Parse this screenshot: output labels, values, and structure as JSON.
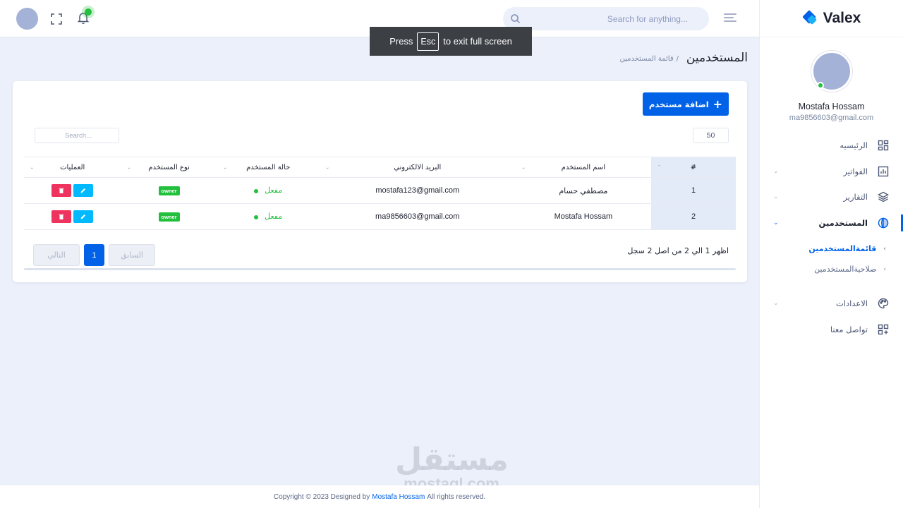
{
  "brand": {
    "name": "Valex"
  },
  "user": {
    "name": "Mostafa Hossam",
    "email": "ma9856603@gmail.com"
  },
  "sidebar": {
    "items": [
      {
        "label": "الرئيسيه",
        "icon": "dashboard-icon"
      },
      {
        "label": "الفواتير",
        "icon": "invoices-chart-icon"
      },
      {
        "label": "التقارير",
        "icon": "layers-icon"
      },
      {
        "label": "المستخدمين",
        "icon": "globe-icon"
      },
      {
        "label": "الاعدادات",
        "icon": "palette-icon"
      },
      {
        "label": "تواصل معنا",
        "icon": "grid-icon"
      }
    ],
    "sub_items": [
      {
        "label": "قائمةالمستخدمين"
      },
      {
        "label": "صلاحيةالمستخدمين"
      }
    ]
  },
  "header": {
    "search_placeholder": "Search for anything..."
  },
  "toast": {
    "press": "Press",
    "key": "Esc",
    "rest": "to exit full screen"
  },
  "breadcrumb": {
    "title": "المستخدمين",
    "separator": "/",
    "current": "قائمة المستخدمين"
  },
  "card": {
    "add_button": "اضافة مستخدم",
    "page_length": "50",
    "search_placeholder": "Search..."
  },
  "table": {
    "headers": [
      "#",
      "اسم المستخدم",
      "البريد الالكتروني",
      "حالة المستخدم",
      "نوع المستخدم",
      "العمليات"
    ],
    "rows": [
      {
        "num": "1",
        "name": "مصطفي حسام",
        "email": "mostafa123@gmail.com",
        "status": "مفعل",
        "type": "owner"
      },
      {
        "num": "2",
        "name": "Mostafa Hossam",
        "email": "ma9856603@gmail.com",
        "status": "مفعل",
        "type": "owner"
      }
    ],
    "info": "اظهر 1 الي 2 من اصل 2 سجل",
    "pager": {
      "prev": "السابق",
      "current": "1",
      "next": "التالي"
    }
  },
  "footer": {
    "prefix": "Copyright © 2023 Designed by",
    "author": "Mostafa Hossam",
    "suffix": "All rights reserved."
  },
  "watermark": {
    "arabic": "مستقل",
    "latin": "mostaql.com"
  },
  "colors": {
    "primary": "#0162e8",
    "success": "#22c03c",
    "danger": "#ee335e",
    "info": "#00b9ff",
    "background": "#ecf0fa"
  }
}
